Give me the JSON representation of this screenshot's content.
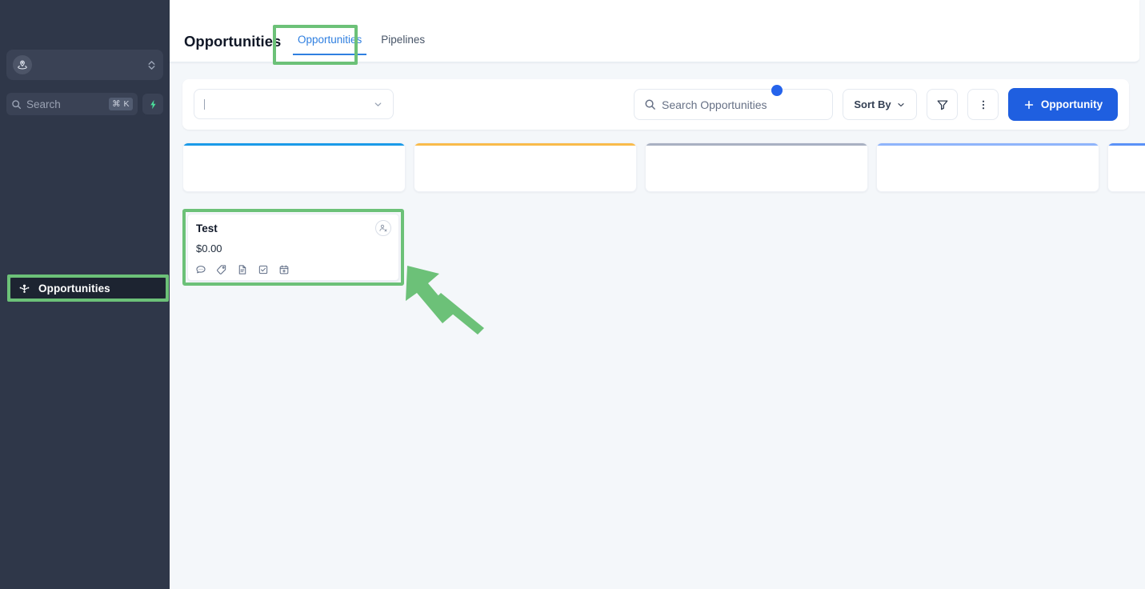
{
  "sidebar": {
    "org_switcher": {
      "icon": "location-avatar-icon",
      "chevrons_icon": "chevrons-up-down-icon"
    },
    "search": {
      "icon": "search-icon",
      "placeholder": "Search",
      "shortcut": "⌘ K",
      "bolt_icon": "lightning-bolt-icon"
    },
    "nav_items": [
      {
        "label": "Opportunities",
        "icon": "opportunities-icon",
        "active": true
      }
    ]
  },
  "header": {
    "title": "Opportunities",
    "tabs": [
      {
        "label": "Opportunities",
        "active": true
      },
      {
        "label": "Pipelines",
        "active": false
      }
    ]
  },
  "toolbar": {
    "pipeline_select": {
      "value": "",
      "chevron_icon": "chevron-down-icon"
    },
    "search": {
      "placeholder": "Search Opportunities",
      "icon": "search-icon"
    },
    "sort_by": {
      "label": "Sort By",
      "chevron_icon": "chevron-down-icon"
    },
    "filter_button": {
      "icon": "filter-funnel-icon",
      "has_badge": true
    },
    "more_button": {
      "icon": "kebab-menu-icon"
    },
    "add_button": {
      "label": "Opportunity",
      "icon": "plus-icon"
    }
  },
  "board": {
    "columns": [
      {
        "name": "column-1",
        "accent": "#1a9ae8",
        "title": ""
      },
      {
        "name": "column-2",
        "accent": "#f9bb4b",
        "title": ""
      },
      {
        "name": "column-3",
        "accent": "#a9b1c2",
        "title": ""
      },
      {
        "name": "column-4",
        "accent": "#8fb4fb",
        "title": ""
      },
      {
        "name": "column-5",
        "accent": "#5a91f7",
        "title": ""
      }
    ],
    "cards": [
      {
        "title": "Test",
        "amount": "$0.00",
        "avatar_icon": "user-unassigned-icon",
        "action_icons": [
          "chat-bubble-icon",
          "tag-icon",
          "document-icon",
          "task-checkbox-icon",
          "calendar-add-icon"
        ]
      }
    ]
  },
  "annotations": {
    "highlight_color": "#6cc178",
    "arrow": "green-arrow-pointing-to-card"
  },
  "colors": {
    "sidebar_bg": "#2f3749",
    "main_bg": "#f4f7fa",
    "primary": "#1f5fe0",
    "tab_active": "#2f7fe0",
    "badge": "#2563eb"
  }
}
